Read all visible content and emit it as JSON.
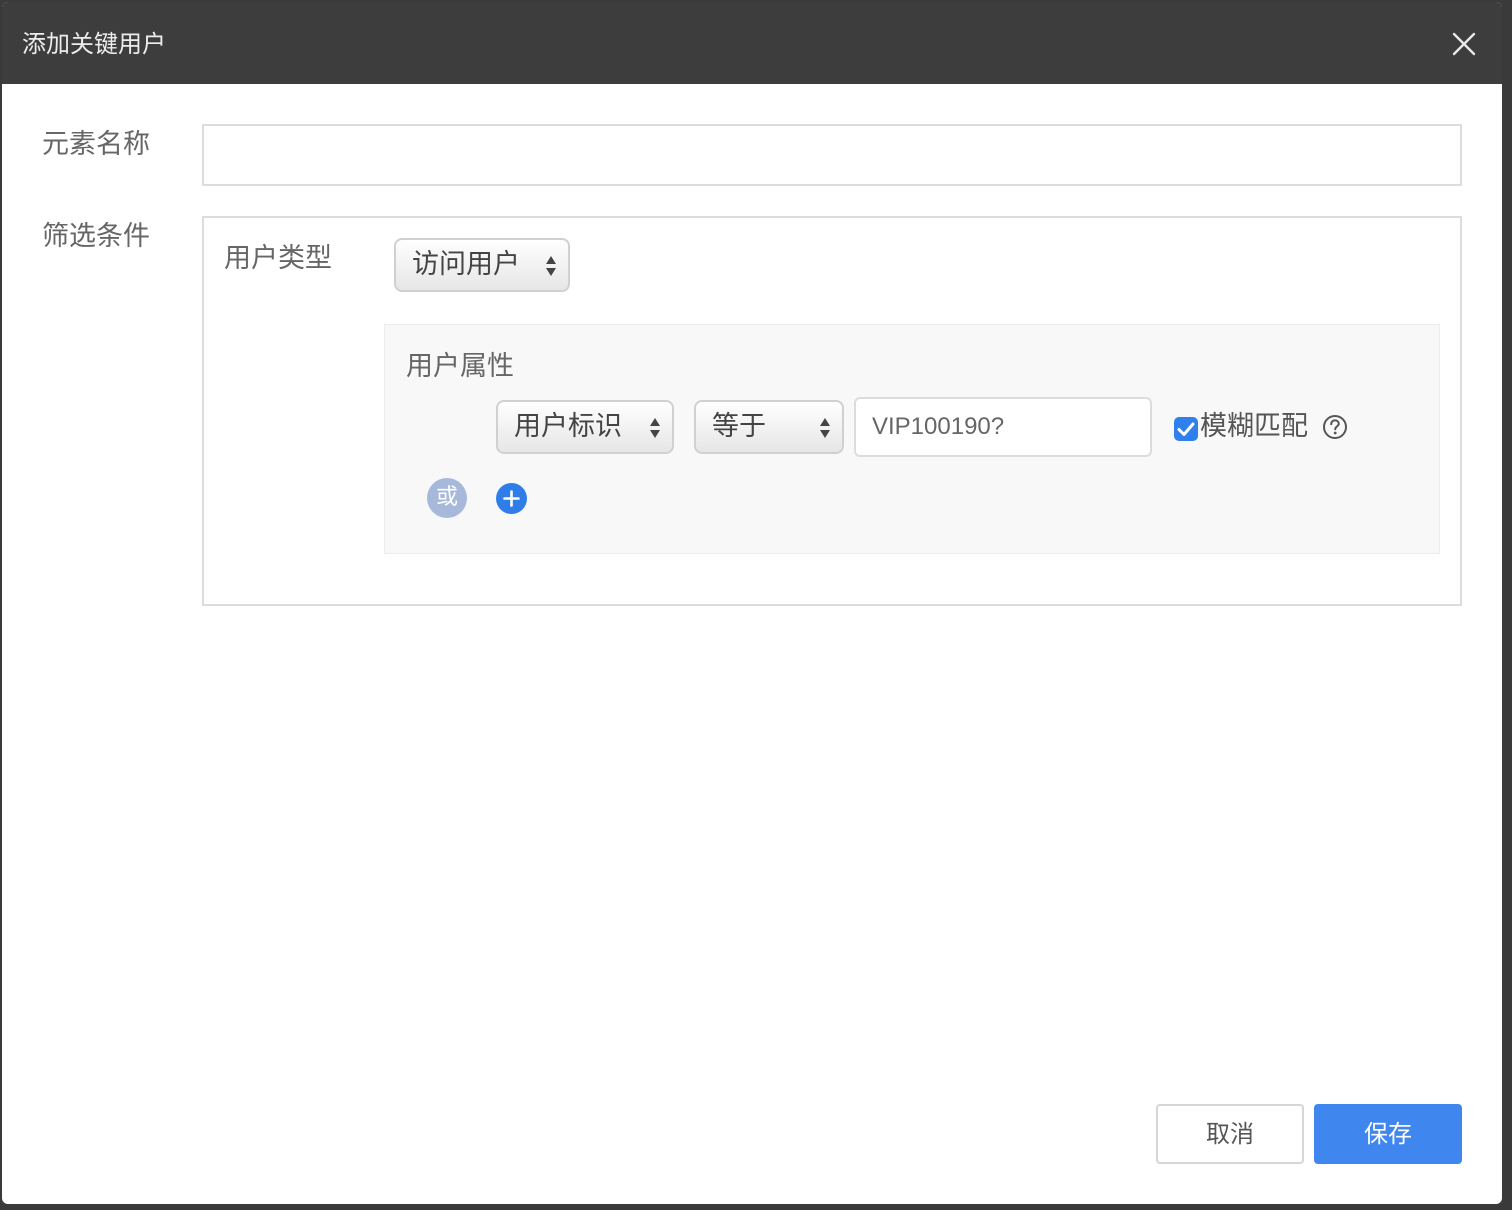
{
  "dialog": {
    "title": "添加关键用户"
  },
  "form": {
    "element_name_label": "元素名称",
    "element_name_value": "",
    "filter_label": "筛选条件",
    "user_type_label": "用户类型",
    "user_type_selected": "访问用户",
    "attribute_label": "用户属性",
    "condition": {
      "field_selected": "用户标识",
      "operator_selected": "等于",
      "value": "VIP100190?",
      "fuzzy_match_label": "模糊匹配",
      "fuzzy_match_checked": true
    },
    "or_label": "或"
  },
  "footer": {
    "cancel_label": "取消",
    "save_label": "保存"
  },
  "icons": {
    "close": "close-icon",
    "help": "help-circle-icon",
    "add": "plus-circle-icon",
    "select_arrows": "updown-arrows-icon",
    "check": "check-icon"
  },
  "colors": {
    "titlebar": "#3d3d3d",
    "primary": "#3f87ee",
    "or_badge": "#a7b9db",
    "panel_bg": "#f8f8f8"
  }
}
